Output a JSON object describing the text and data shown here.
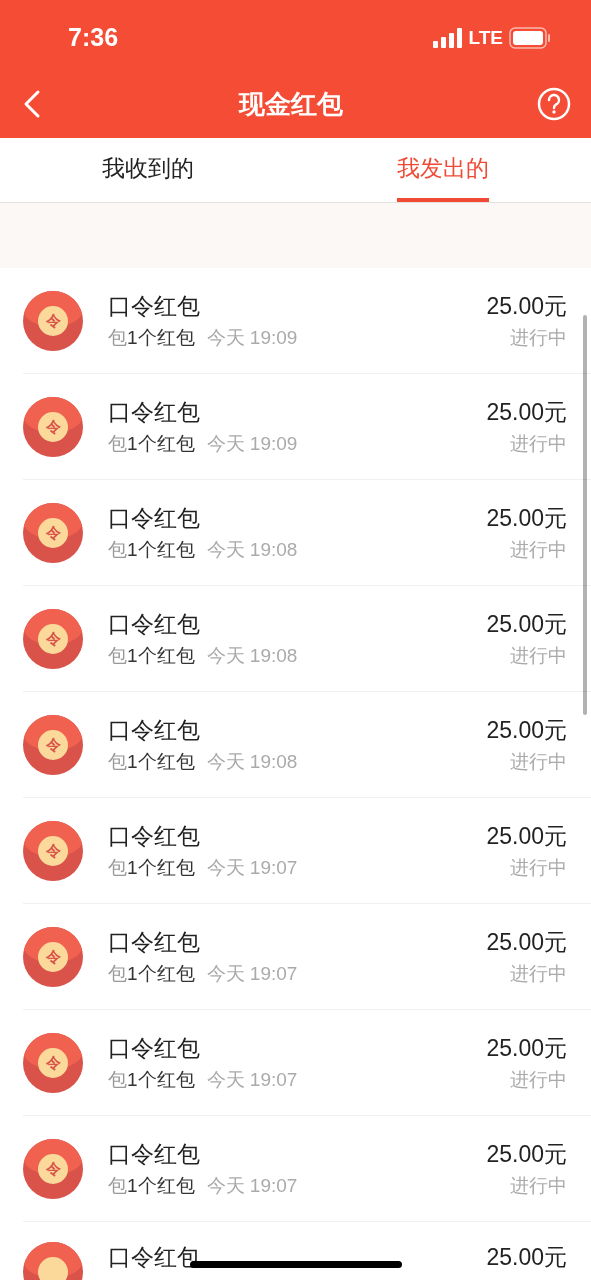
{
  "status_bar": {
    "time": "7:36",
    "network": "LTE"
  },
  "nav": {
    "title": "现金红包"
  },
  "tabs": [
    {
      "label": "我收到的",
      "selected": false
    },
    {
      "label": "我发出的",
      "selected": true
    }
  ],
  "records": [
    {
      "badge": "令",
      "title": "口令红包",
      "prefix": "包",
      "count": "1个红包",
      "time": "今天 19:09",
      "amount": "25.00元",
      "status": "进行中"
    },
    {
      "badge": "令",
      "title": "口令红包",
      "prefix": "包",
      "count": "1个红包",
      "time": "今天 19:09",
      "amount": "25.00元",
      "status": "进行中"
    },
    {
      "badge": "令",
      "title": "口令红包",
      "prefix": "包",
      "count": "1个红包",
      "time": "今天 19:08",
      "amount": "25.00元",
      "status": "进行中"
    },
    {
      "badge": "令",
      "title": "口令红包",
      "prefix": "包",
      "count": "1个红包",
      "time": "今天 19:08",
      "amount": "25.00元",
      "status": "进行中"
    },
    {
      "badge": "令",
      "title": "口令红包",
      "prefix": "包",
      "count": "1个红包",
      "time": "今天 19:08",
      "amount": "25.00元",
      "status": "进行中"
    },
    {
      "badge": "令",
      "title": "口令红包",
      "prefix": "包",
      "count": "1个红包",
      "time": "今天 19:07",
      "amount": "25.00元",
      "status": "进行中"
    },
    {
      "badge": "令",
      "title": "口令红包",
      "prefix": "包",
      "count": "1个红包",
      "time": "今天 19:07",
      "amount": "25.00元",
      "status": "进行中"
    },
    {
      "badge": "令",
      "title": "口令红包",
      "prefix": "包",
      "count": "1个红包",
      "time": "今天 19:07",
      "amount": "25.00元",
      "status": "进行中"
    },
    {
      "badge": "令",
      "title": "口令红包",
      "prefix": "包",
      "count": "1个红包",
      "time": "今天 19:07",
      "amount": "25.00元",
      "status": "进行中"
    },
    {
      "title": "口令红包",
      "amount": "25.00元"
    }
  ]
}
